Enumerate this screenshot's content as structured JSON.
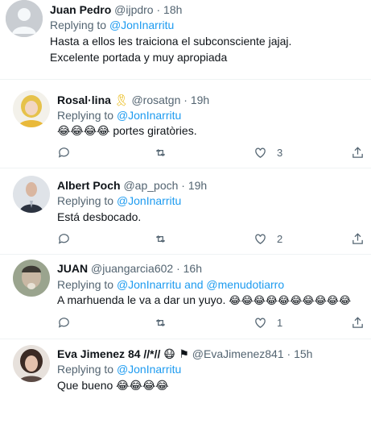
{
  "tweets": [
    {
      "name": "Juan Pedro",
      "handle": "@ijpdro",
      "time": "18h",
      "replying_prefix": "Replying to ",
      "replying_to": "@JonInarritu",
      "text_line1": "Hasta a ellos les traiciona el subconsciente jajaj.",
      "text_line2": "Excelente portada y muy apropiada",
      "avatar_color": "#c8ccd1"
    },
    {
      "name": "Rosal·lina",
      "badge": "🎗",
      "handle": "@rosatgn",
      "time": "19h",
      "replying_prefix": "Replying to ",
      "replying_to": "@JonInarritu",
      "emojis": "😂😂😂😂",
      "text": " portes giratòries.",
      "likes": "3",
      "avatar_color": "#e6c24a"
    },
    {
      "name": "Albert Poch",
      "handle": "@ap_poch",
      "time": "19h",
      "replying_prefix": "Replying to ",
      "replying_to": "@JonInarritu",
      "text": "Está desbocado.",
      "likes": "2",
      "avatar_color": "#3a3f4a"
    },
    {
      "name": "JUAN",
      "handle": "@juangarcia602",
      "time": "16h",
      "replying_prefix": "Replying to ",
      "replying_to": "@JonInarritu and @menudotiarro",
      "text": "A marhuenda le va a dar un yuyo. ",
      "emojis": "😂😂😂😂😂😂😂😂😂😂",
      "likes": "1",
      "avatar_color": "#7d8a6e"
    },
    {
      "name": "Eva Jimenez 84 //*//",
      "badges": "😷 ⚑",
      "handle": "@EvaJimenez841",
      "time": "15h",
      "replying_prefix": "Replying to ",
      "replying_to": "@JonInarritu",
      "text": "Que bueno ",
      "emojis": "😂😂😂😂",
      "avatar_color": "#5b4a44"
    }
  ],
  "separator": " · ",
  "colors": {
    "link": "#1d9bf0",
    "secondary": "#536471",
    "divider": "#eff3f4"
  }
}
